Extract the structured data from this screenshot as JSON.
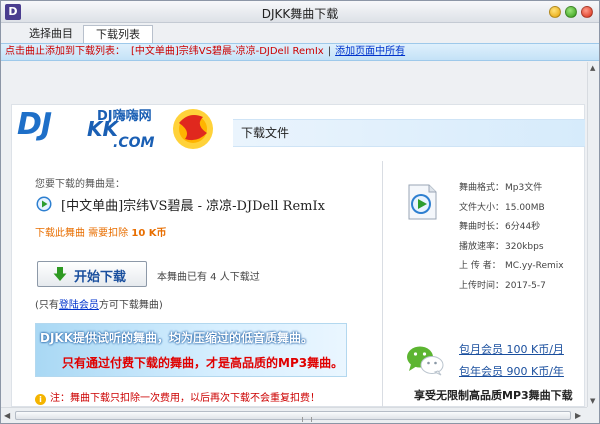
{
  "window": {
    "title": "DJKK舞曲下载",
    "app_icon_letter": "D"
  },
  "tabs": [
    {
      "label": "选择曲目",
      "active": false
    },
    {
      "label": "下载列表",
      "active": true
    }
  ],
  "infobar": {
    "prompt": "点击曲止添加到下载列表：",
    "song": "[中文单曲]宗纬VS碧晨-凉凉-DJDell RemIx",
    "separator": "|",
    "add_all_link": "添加页面中所有"
  },
  "logo": {
    "dj": "DJ",
    "kk": "KK",
    "cn": "DJ嗨嗨网",
    "com": ".COM"
  },
  "download_header": "下载文件",
  "song_section": {
    "label": "您要下载的舞曲是：",
    "title": "[中文单曲]宗纬VS碧晨 - 凉凉-DJDell RemIx",
    "cost_prefix": "下载此舞曲 需要扣除",
    "cost_value": "10 K币",
    "download_button": "开始下载",
    "download_count": "本舞曲已有 4 人下载过",
    "member_note_prefix": "(只有",
    "member_note_link": "登陆会员",
    "member_note_suffix": "方可下载舞曲)"
  },
  "promo": {
    "line1": "DJKK提供试听的舞曲，均为压缩过的低音质舞曲。",
    "line2": "只有通过付费下载的舞曲，才是高品质的MP3舞曲。"
  },
  "notice": "注：舞曲下载只扣除一次费用，以后再次下载不会重复扣费！",
  "file_meta": [
    {
      "key": "舞曲格式：",
      "value": "Mp3文件"
    },
    {
      "key": "文件大小：",
      "value": "15.00MB"
    },
    {
      "key": "舞曲时长：",
      "value": "6分44秒"
    },
    {
      "key": "播放速率：",
      "value": "320kbps"
    },
    {
      "key": "上 传 者：",
      "value": "MC.yy-Remix"
    },
    {
      "key": "上传时间：",
      "value": "2017-5-7"
    }
  ],
  "plans": [
    "包月会员 100 K币/月",
    "包年会员 900 K币/年"
  ],
  "enjoy_text": "享受无限制高品质MP3舞曲下载",
  "colors": {
    "accent_blue": "#1a4f9e",
    "warning_red": "#cc0000",
    "cost_orange": "#e86e00",
    "info_bar_bg": "#c4e2f7"
  }
}
